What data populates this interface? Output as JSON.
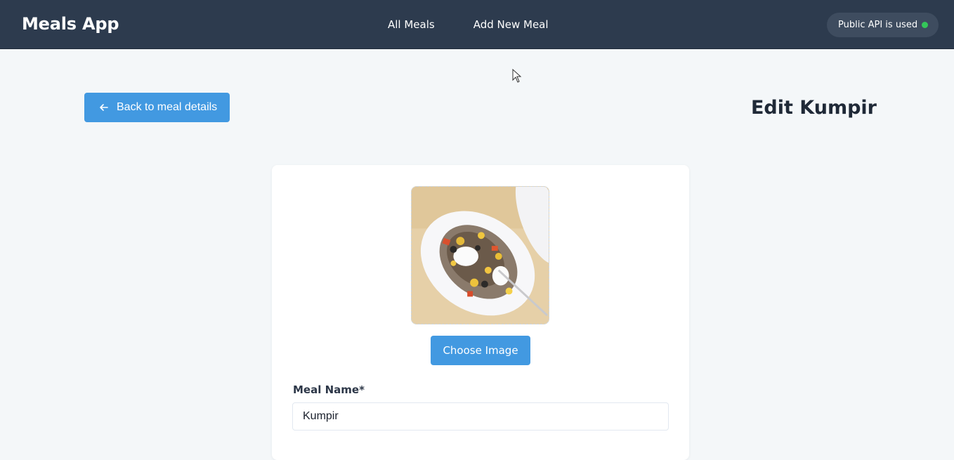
{
  "navbar": {
    "brand": "Meals App",
    "links": [
      {
        "label": "All Meals"
      },
      {
        "label": "Add New Meal"
      }
    ],
    "api_status": "Public API is used",
    "api_status_color": "#34c759"
  },
  "header": {
    "back_label": "Back to meal details",
    "page_title": "Edit Kumpir"
  },
  "form": {
    "choose_image_label": "Choose Image",
    "meal_name_label": "Meal Name*",
    "meal_name_value": "Kumpir"
  },
  "colors": {
    "navbar_bg": "#2d3b4e",
    "accent": "#4299e1",
    "page_bg": "#f4f7f9"
  }
}
